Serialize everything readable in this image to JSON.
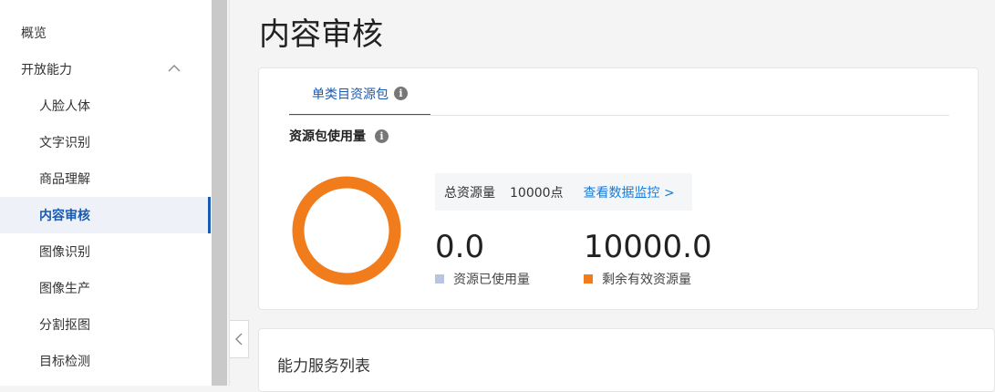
{
  "sidebar": {
    "items": [
      {
        "label": "概览"
      },
      {
        "label": "开放能力"
      },
      {
        "label": "人脸人体"
      },
      {
        "label": "文字识别"
      },
      {
        "label": "商品理解"
      },
      {
        "label": "内容审核"
      },
      {
        "label": "图像识别"
      },
      {
        "label": "图像生产"
      },
      {
        "label": "分割抠图"
      },
      {
        "label": "目标检测"
      }
    ]
  },
  "page": {
    "title": "内容审核"
  },
  "resource": {
    "tab_label": "单类目资源包",
    "section_title": "资源包使用量",
    "total_label": "总资源量",
    "total_value": "10000点",
    "monitor_link": "查看数据监控 >",
    "used_value": "0.0",
    "remaining_value": "10000.0",
    "used_label": "资源已使用量",
    "remaining_label": "剩余有效资源量",
    "used_color": "#b9c4e0",
    "remaining_color": "#f07c1c",
    "used_fraction": 0.0
  },
  "service_list": {
    "title": "能力服务列表"
  }
}
